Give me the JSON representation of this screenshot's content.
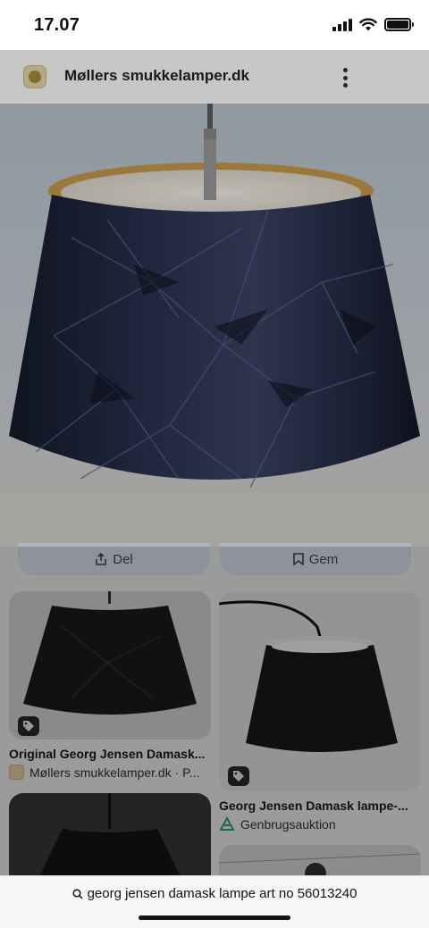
{
  "status": {
    "time": "17.07"
  },
  "site": {
    "name": "Møllers smukkelamper.dk"
  },
  "actions": {
    "share_label": "Del",
    "save_label": "Gem"
  },
  "results": [
    {
      "title": "Original Georg Jensen Damask...",
      "source": "Møllers smukkelamper.dk · P..."
    },
    {
      "title": "Georg Jensen Damask lampe-...",
      "source": "Genbrugsauktion"
    }
  ],
  "search": {
    "query": "georg jensen damask lampe art no 56013240"
  },
  "colors": {
    "shade": "#1f2538",
    "accent_blue": "#dfe6f2",
    "genbrug_green": "#3aa06a"
  }
}
